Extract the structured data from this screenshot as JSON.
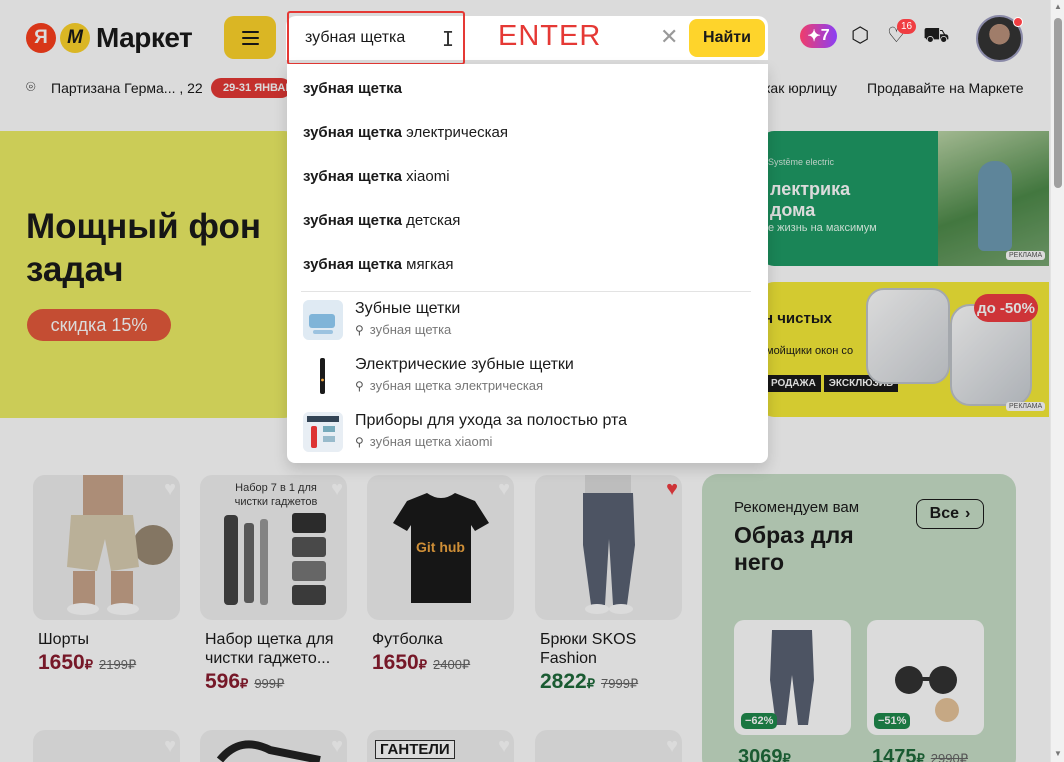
{
  "header": {
    "logo_ya": "Я",
    "logo_m": "М",
    "logo_text": "Маркет",
    "search_value": "зубная щетка",
    "enter_label": "ENTER",
    "find_button": "Найти",
    "plus_points": "7",
    "favorites_count": "16",
    "icons": [
      "hamburger-menu-icon",
      "text-cursor-icon",
      "clear-icon",
      "plus-icon",
      "box-icon",
      "heart-icon",
      "cart-icon",
      "avatar"
    ]
  },
  "subbar": {
    "address": "Партизана Герма... , 22",
    "promo": "29-31 ЯНВАРЯ",
    "link_business": "как юрлицу",
    "link_sell": "Продавайте на Маркете"
  },
  "banners": {
    "main_title": "Мощный фон\nзадач",
    "main_discount": "скидка 15%",
    "green_brand": "Systēme electric",
    "green_title": "лектрика\nдома",
    "green_sub": "е жизнь на максимум",
    "green_ad": "РЕКЛАМА",
    "yellow_title": "н чистых",
    "yellow_sub": "мойщики окон со",
    "yellow_tag1": "РОДАЖА",
    "yellow_tag2": "ЭКСКЛЮЗИВ",
    "yellow_discount": "до -50%",
    "yellow_ad": "РЕКЛАМА"
  },
  "suggestions": {
    "items": [
      {
        "bold": "зубная щетка",
        "rest": ""
      },
      {
        "bold": "зубная щетка",
        "rest": " электрическая"
      },
      {
        "bold": "зубная щетка",
        "rest": " xiaomi"
      },
      {
        "bold": "зубная щетка",
        "rest": " детская"
      },
      {
        "bold": "зубная щетка",
        "rest": " мягкая"
      }
    ],
    "categories": [
      {
        "title": "Зубные щетки",
        "sub": "зубная щетка"
      },
      {
        "title": "Электрические зубные щетки",
        "sub": "зубная щетка электрическая"
      },
      {
        "title": "Приборы для ухода за полостью рта",
        "sub": "зубная щетка xiaomi"
      }
    ]
  },
  "products": [
    {
      "name": "Шорты",
      "price": "1650",
      "old": "2199",
      "currency": "₽"
    },
    {
      "name": "Набор щетка для чистки гаджето...",
      "price": "596",
      "old": "999",
      "currency": "₽",
      "img_text": "Набор 7 в 1 для чистки гаджетов"
    },
    {
      "name": "Футболка",
      "price": "1650",
      "old": "2400",
      "currency": "₽",
      "img_text": "Git hub"
    },
    {
      "name": "Брюки SKOS Fashion",
      "price": "2822",
      "old": "7999",
      "currency": "₽"
    }
  ],
  "row2": {
    "img_text": "ГАНТЕЛИ"
  },
  "recommend": {
    "caption": "Рекомендуем вам",
    "title": "Образ для\nнего",
    "all_button": "Все",
    "cards": [
      {
        "discount": "−62%",
        "price": "3069",
        "old": "",
        "currency": "₽"
      },
      {
        "discount": "−51%",
        "price": "1475",
        "old": "2990",
        "currency": "₽"
      }
    ]
  }
}
